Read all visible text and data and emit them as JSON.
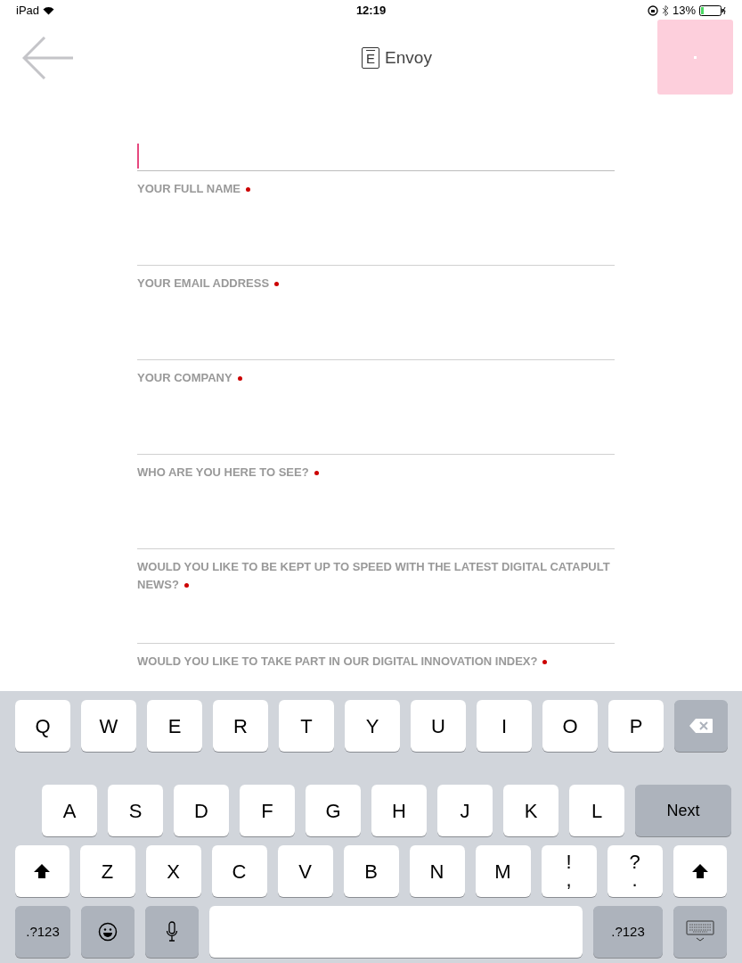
{
  "status_bar": {
    "device": "iPad",
    "time": "12:19",
    "battery": "13%"
  },
  "header": {
    "logo_letter": "E",
    "title": "Envoy"
  },
  "fields": [
    {
      "label": "YOUR FULL NAME",
      "required": true,
      "focused": true
    },
    {
      "label": "YOUR EMAIL ADDRESS",
      "required": true,
      "focused": false
    },
    {
      "label": "YOUR COMPANY",
      "required": true,
      "focused": false
    },
    {
      "label": "WHO ARE YOU HERE TO SEE?",
      "required": true,
      "focused": false
    },
    {
      "label": "WOULD YOU LIKE TO BE KEPT UP TO SPEED WITH THE LATEST DIGITAL CATAPULT NEWS?",
      "required": true,
      "focused": false
    },
    {
      "label": "WOULD YOU LIKE TO TAKE PART IN OUR DIGITAL INNOVATION INDEX?",
      "required": true,
      "focused": false
    }
  ],
  "keyboard": {
    "rows": [
      {
        "keys": [
          {
            "kind": "char",
            "label": "Q"
          },
          {
            "kind": "char",
            "label": "W"
          },
          {
            "kind": "char",
            "label": "E"
          },
          {
            "kind": "char",
            "label": "R"
          },
          {
            "kind": "char",
            "label": "T"
          },
          {
            "kind": "char",
            "label": "Y"
          },
          {
            "kind": "char",
            "label": "U"
          },
          {
            "kind": "char",
            "label": "I"
          },
          {
            "kind": "char",
            "label": "O"
          },
          {
            "kind": "char",
            "label": "P"
          },
          {
            "kind": "backspace"
          }
        ]
      },
      {
        "keys": [
          {
            "kind": "char",
            "label": "A"
          },
          {
            "kind": "char",
            "label": "S"
          },
          {
            "kind": "char",
            "label": "D"
          },
          {
            "kind": "char",
            "label": "F"
          },
          {
            "kind": "char",
            "label": "G"
          },
          {
            "kind": "char",
            "label": "H"
          },
          {
            "kind": "char",
            "label": "J"
          },
          {
            "kind": "char",
            "label": "K"
          },
          {
            "kind": "char",
            "label": "L"
          },
          {
            "kind": "action",
            "label": "Next"
          }
        ]
      },
      {
        "keys": [
          {
            "kind": "shift"
          },
          {
            "kind": "char",
            "label": "Z"
          },
          {
            "kind": "char",
            "label": "X"
          },
          {
            "kind": "char",
            "label": "C"
          },
          {
            "kind": "char",
            "label": "V"
          },
          {
            "kind": "char",
            "label": "B"
          },
          {
            "kind": "char",
            "label": "N"
          },
          {
            "kind": "char",
            "label": "M"
          },
          {
            "kind": "dual",
            "label": "!",
            "sub": ","
          },
          {
            "kind": "dual",
            "label": "?",
            "sub": "."
          },
          {
            "kind": "shift"
          }
        ]
      },
      {
        "keys": [
          {
            "kind": "mode",
            "label": ".?123"
          },
          {
            "kind": "emoji"
          },
          {
            "kind": "mic"
          },
          {
            "kind": "space"
          },
          {
            "kind": "mode",
            "label": ".?123"
          },
          {
            "kind": "hide"
          }
        ]
      }
    ]
  }
}
